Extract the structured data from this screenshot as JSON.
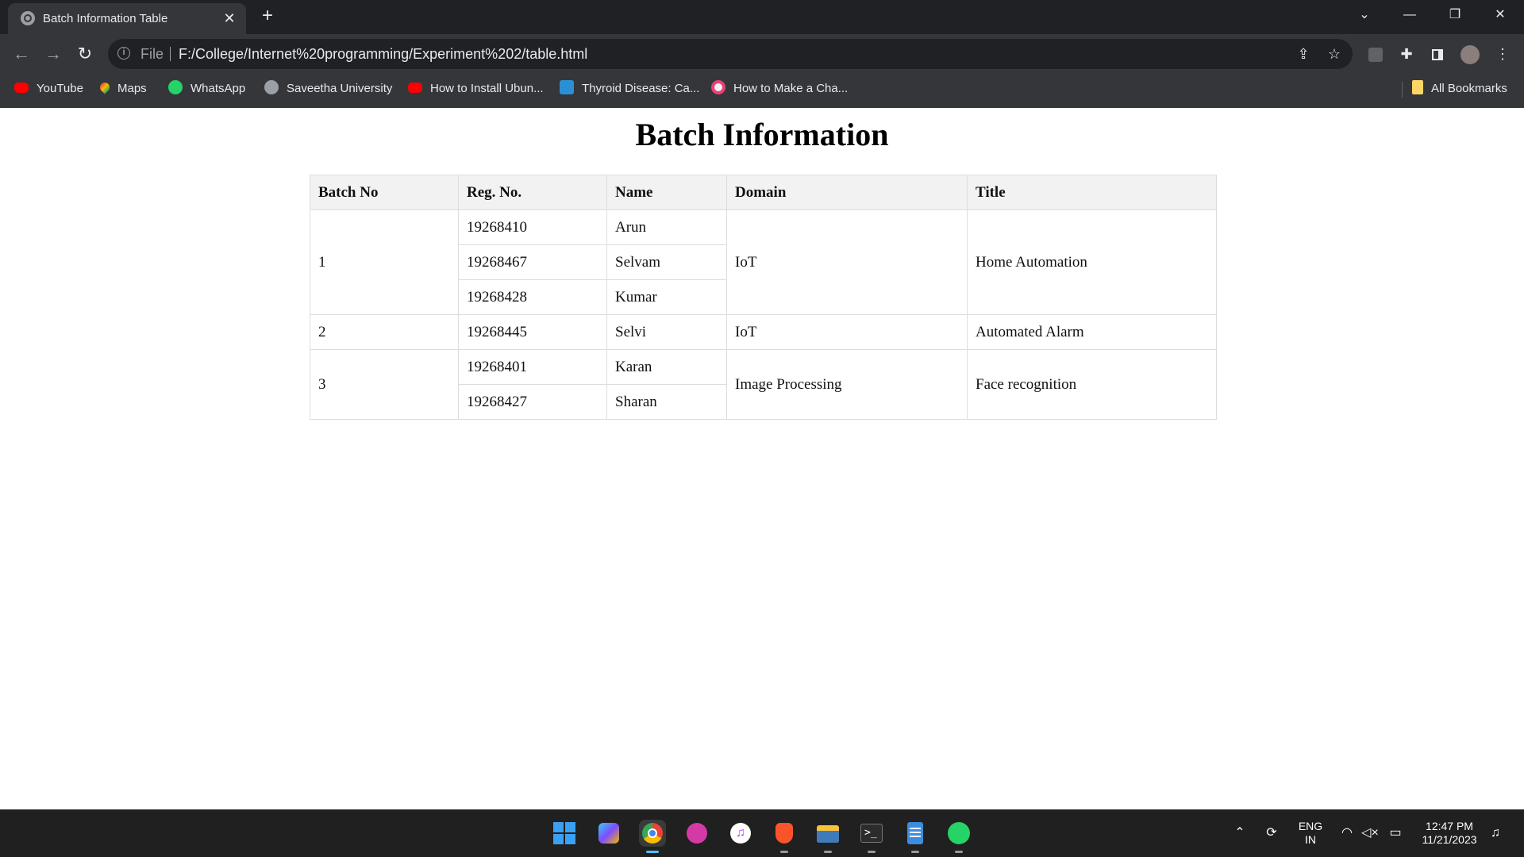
{
  "browser": {
    "tab_title": "Batch Information Table",
    "address_scheme": "File",
    "address_url": "F:/College/Internet%20programming/Experiment%202/table.html",
    "bookmarks": [
      {
        "label": "YouTube",
        "icon": "youtube-icon"
      },
      {
        "label": "Maps",
        "icon": "maps-icon"
      },
      {
        "label": "WhatsApp",
        "icon": "whatsapp-icon"
      },
      {
        "label": "Saveetha University",
        "icon": "globe-icon"
      },
      {
        "label": "How to Install Ubun...",
        "icon": "youtube-icon"
      },
      {
        "label": "Thyroid Disease: Ca...",
        "icon": "site-icon"
      },
      {
        "label": "How to Make a Cha...",
        "icon": "site-icon"
      }
    ],
    "all_bookmarks": "All Bookmarks"
  },
  "page": {
    "title": "Batch Information",
    "headers": [
      "Batch No",
      "Reg. No.",
      "Name",
      "Domain",
      "Title"
    ],
    "batches": [
      {
        "no": "1",
        "domain": "IoT",
        "title": "Home Automation",
        "members": [
          {
            "reg": "19268410",
            "name": "Arun"
          },
          {
            "reg": "19268467",
            "name": "Selvam"
          },
          {
            "reg": "19268428",
            "name": "Kumar"
          }
        ]
      },
      {
        "no": "2",
        "domain": "IoT",
        "title": "Automated Alarm",
        "members": [
          {
            "reg": "19268445",
            "name": "Selvi"
          }
        ]
      },
      {
        "no": "3",
        "domain": "Image Processing",
        "title": "Face recognition",
        "members": [
          {
            "reg": "19268401",
            "name": "Karan"
          },
          {
            "reg": "19268427",
            "name": "Sharan"
          }
        ]
      }
    ]
  },
  "taskbar": {
    "lang_line1": "ENG",
    "lang_line2": "IN",
    "time": "12:47 PM",
    "date": "11/21/2023",
    "pinned_apps": [
      "windows-start-icon",
      "copilot-icon",
      "chrome-icon",
      "wps-icon",
      "itunes-icon",
      "brave-icon",
      "file-explorer-icon",
      "terminal-icon",
      "notepad-icon",
      "whatsapp-icon"
    ]
  },
  "colors": {
    "chrome_dark": "#202124",
    "chrome_toolbar": "#35363a",
    "table_border": "#dddddd",
    "table_header_bg": "#f2f2f2",
    "taskbar_bg": "#202020",
    "accent": "#4cc2ff"
  }
}
